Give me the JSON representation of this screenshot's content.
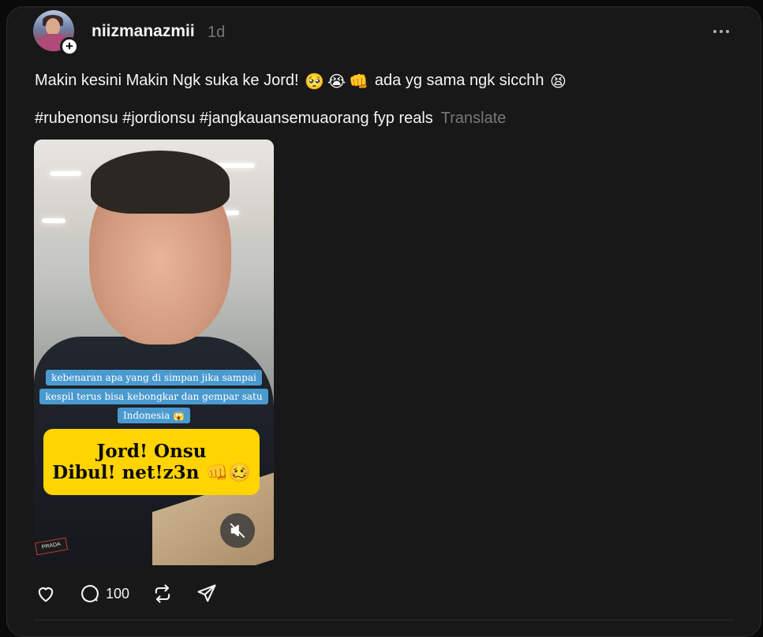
{
  "post": {
    "username": "niizmanazmii",
    "timestamp": "1d",
    "caption_text_1": "Makin kesini Makin Ngk suka ke Jord!",
    "caption_emoji_1": "🥺",
    "caption_emoji_2": "😭",
    "caption_emoji_3": "👊",
    "caption_text_2": "ada yg sama ngk sicchh",
    "caption_emoji_4": "😫",
    "hashtags": "#rubenonsu #jordionsu #jangkauansemuaorang fyp reals",
    "translate_label": "Translate",
    "follow_symbol": "+"
  },
  "video": {
    "subtitle": "kebenaran apa yang di simpan jika sampai kespil terus bisa kebongkar dan gempar satu Indonesia 😱",
    "title_line_1": "Jord! Onsu",
    "title_line_2": "Dibul! net!z3n 👊🥴",
    "brand_tag": "PRADA"
  },
  "actions": {
    "comment_count": "100"
  },
  "colors": {
    "background": "#181818",
    "text": "#f3f5f7",
    "muted": "#777777",
    "subtitle_bg": "#4a9ad0",
    "title_bg": "#ffd400"
  },
  "icons": [
    "more-icon",
    "follow-plus-icon",
    "mute-icon",
    "heart-icon",
    "comment-icon",
    "repost-icon",
    "share-icon"
  ]
}
